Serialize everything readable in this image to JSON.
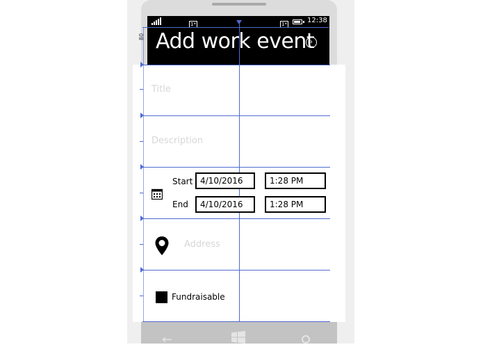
{
  "status_bar": {
    "time": "12:38",
    "ruler_markers": [
      "1*",
      "1*"
    ],
    "side_ruler_value": "80"
  },
  "header": {
    "title": "Add work event",
    "next_icon": "chevron-right-circle-icon"
  },
  "form": {
    "title_placeholder": "Title",
    "description_placeholder": "Description",
    "start_label": "Start",
    "end_label": "End",
    "start_date": "4/10/2016",
    "start_time": "1:28 PM",
    "end_date": "4/10/2016",
    "end_time": "1:28 PM",
    "calendar_icon": "calendar-icon",
    "location_icon": "map-pin-icon",
    "address_placeholder": "Address",
    "fundraisable_label": "Fundraisable",
    "fundraisable_checked": true
  },
  "nav": {
    "icons": [
      "back-arrow-icon",
      "windows-icon",
      "search-icon"
    ]
  },
  "colors": {
    "guide_lines": "#4f6bd0",
    "header_bg": "#000000",
    "placeholder": "#d7d7d7"
  }
}
